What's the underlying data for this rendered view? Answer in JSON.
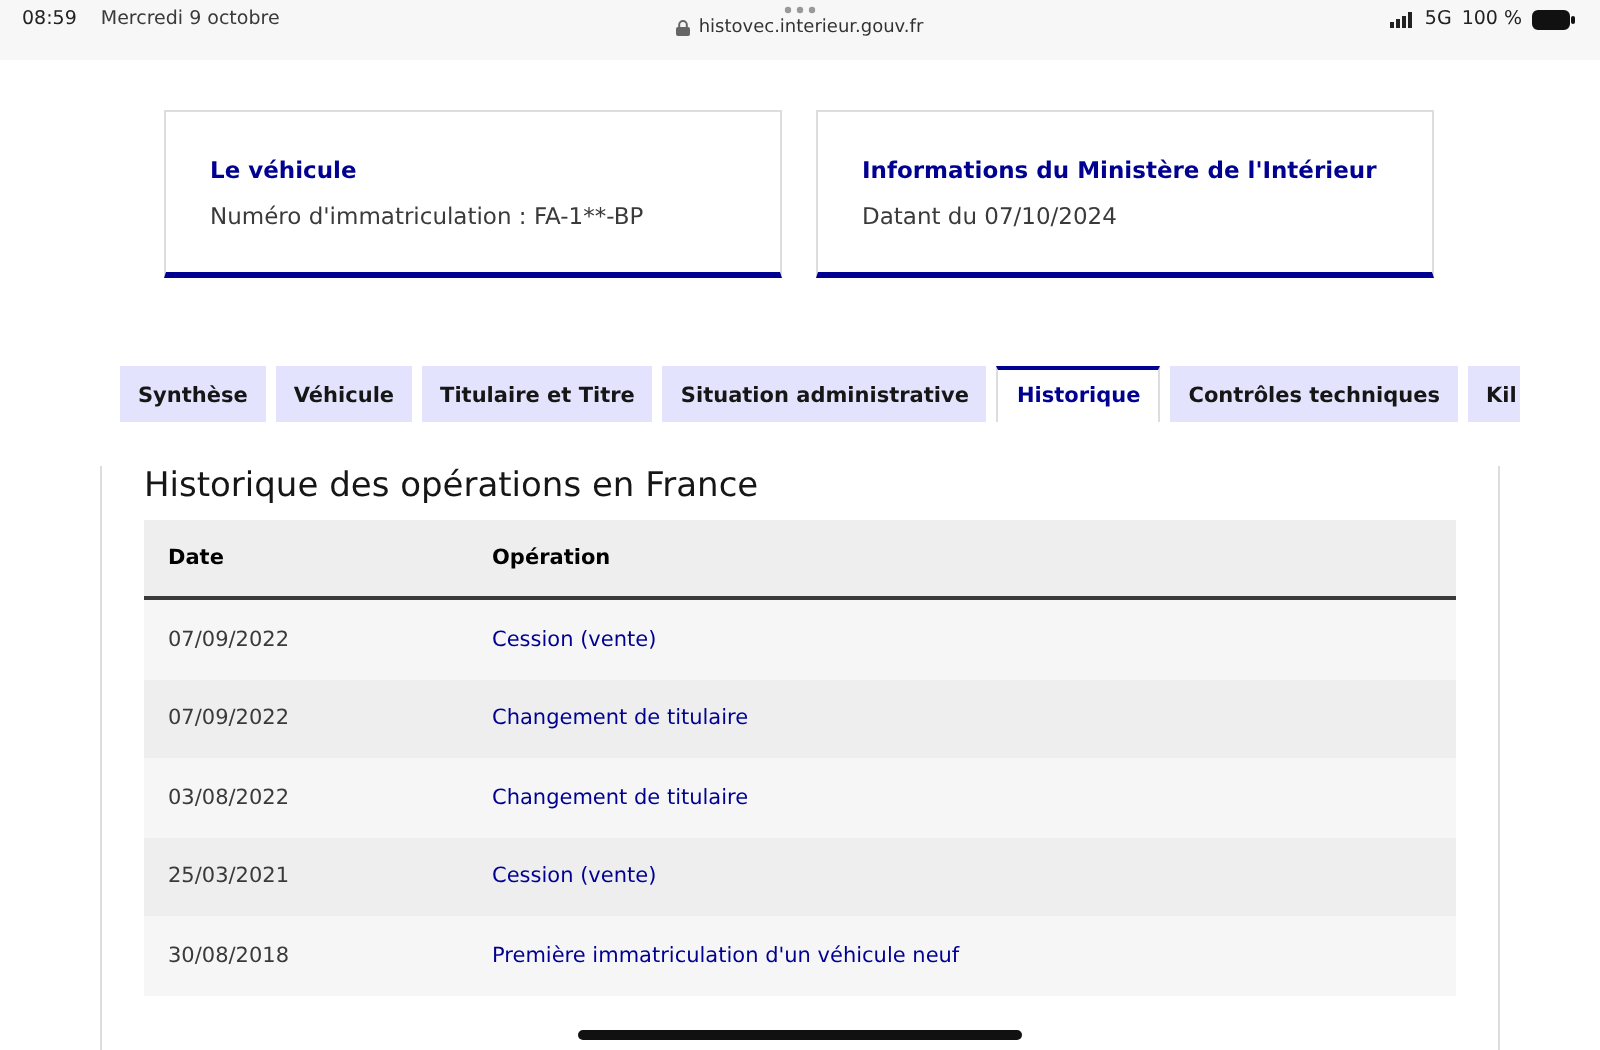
{
  "status_bar": {
    "time": "08:59",
    "date": "Mercredi 9 octobre",
    "url": "histovec.interieur.gouv.fr",
    "network": "5G",
    "battery": "100 %"
  },
  "cards": [
    {
      "title": "Le véhicule",
      "text": "Numéro d'immatriculation : FA-1**-BP"
    },
    {
      "title": "Informations du Ministère de l'Intérieur",
      "text": "Datant du 07/10/2024"
    }
  ],
  "tabs": [
    {
      "label": "Synthèse",
      "selected": false
    },
    {
      "label": "Véhicule",
      "selected": false
    },
    {
      "label": "Titulaire et Titre",
      "selected": false
    },
    {
      "label": "Situation administrative",
      "selected": false
    },
    {
      "label": "Historique",
      "selected": true
    },
    {
      "label": "Contrôles techniques",
      "selected": false
    },
    {
      "label": "Kil",
      "selected": false
    }
  ],
  "panel": {
    "title": "Historique des opérations en France",
    "table": {
      "columns": [
        "Date",
        "Opération"
      ],
      "rows": [
        [
          "07/09/2022",
          "Cession (vente)"
        ],
        [
          "07/09/2022",
          "Changement de titulaire"
        ],
        [
          "03/08/2022",
          "Changement de titulaire"
        ],
        [
          "25/03/2021",
          "Cession (vente)"
        ],
        [
          "30/08/2018",
          "Première immatriculation d'un véhicule neuf"
        ]
      ]
    }
  }
}
